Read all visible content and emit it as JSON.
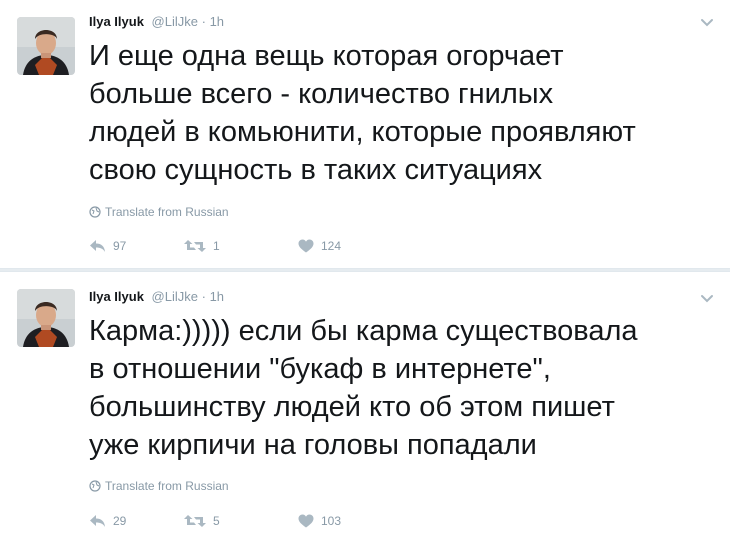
{
  "tweets": [
    {
      "name": "Ilya Ilyuk",
      "handle": "@LilJke",
      "dot": "·",
      "time": "1h",
      "text": "И еще одна вещь которая огорчает\nбольше всего - количество гнилых\nлюдей в комьюнити, которые проявляют\nсвою сущность в таких ситуациях",
      "translate": "Translate from Russian",
      "replies": "97",
      "retweets": "1",
      "likes": "124"
    },
    {
      "name": "Ilya Ilyuk",
      "handle": "@LilJke",
      "dot": "·",
      "time": "1h",
      "text": "Карма:))))) если бы карма существовала\nв отношении \"букаф в интернете\",\nбольшинству людей кто об этом пишет\nуже кирпичи на головы попадали",
      "translate": "Translate from Russian",
      "replies": "29",
      "retweets": "5",
      "likes": "103"
    }
  ],
  "icons": {
    "globe": "globe-icon",
    "reply": "reply-icon",
    "retweet": "retweet-icon",
    "like": "heart-icon",
    "more": "chevron-down-icon"
  },
  "colors": {
    "text": "#14171a",
    "muted": "#8899a6",
    "icon": "#aab8c2",
    "divider": "#e6ecf0"
  }
}
